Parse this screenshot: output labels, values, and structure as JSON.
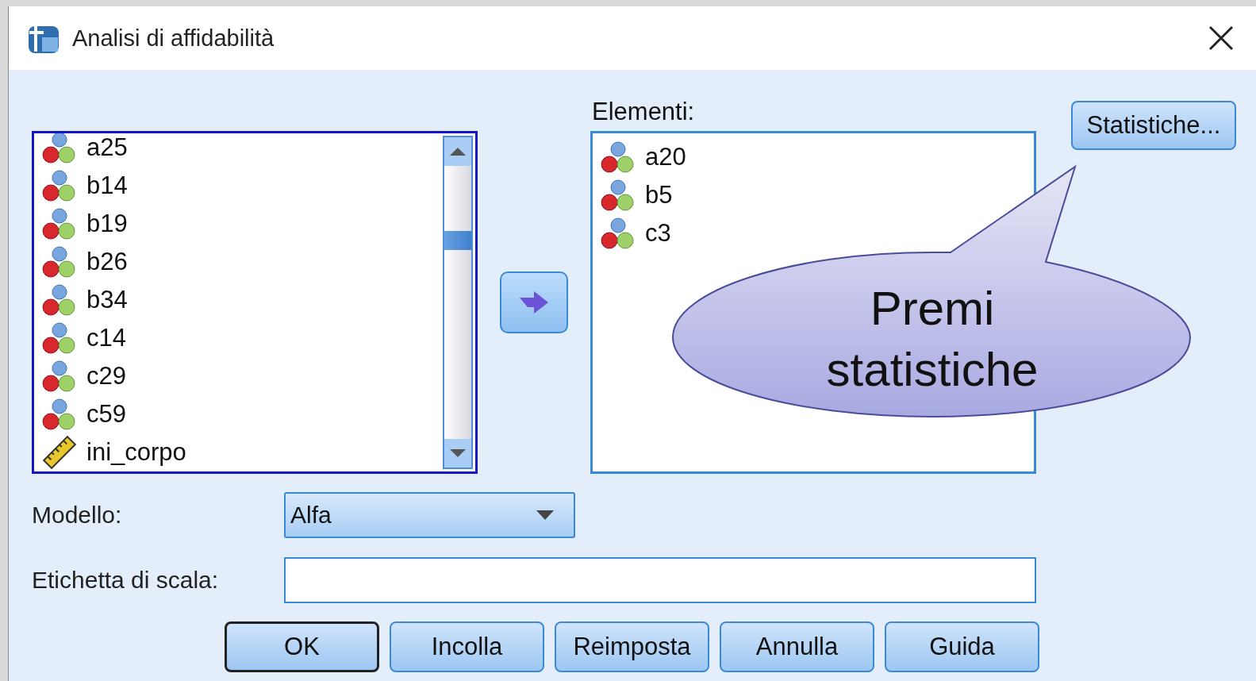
{
  "window": {
    "title": "Analisi di affidabilità"
  },
  "source_list": {
    "focused": true,
    "items": [
      {
        "label": "a25",
        "kind": "nominal"
      },
      {
        "label": "b14",
        "kind": "nominal"
      },
      {
        "label": "b19",
        "kind": "nominal"
      },
      {
        "label": "b26",
        "kind": "nominal"
      },
      {
        "label": "b34",
        "kind": "nominal"
      },
      {
        "label": "c14",
        "kind": "nominal"
      },
      {
        "label": "c29",
        "kind": "nominal"
      },
      {
        "label": "c59",
        "kind": "nominal"
      },
      {
        "label": "ini_corpo",
        "kind": "scale"
      }
    ]
  },
  "target_list": {
    "label": "Elementi:",
    "focused": false,
    "items": [
      {
        "label": "a20",
        "kind": "nominal"
      },
      {
        "label": "b5",
        "kind": "nominal"
      },
      {
        "label": "c3",
        "kind": "nominal"
      }
    ]
  },
  "statistics_button": "Statistiche...",
  "model": {
    "label": "Modello:",
    "value": "Alfa"
  },
  "scale_label": {
    "label": "Etichetta di scala:"
  },
  "buttons": [
    {
      "label": "OK",
      "default": true
    },
    {
      "label": "Incolla",
      "default": false
    },
    {
      "label": "Reimposta",
      "default": false
    },
    {
      "label": "Annulla",
      "default": false
    },
    {
      "label": "Guida",
      "default": false
    }
  ],
  "callout": {
    "text": "Premi statistiche"
  }
}
